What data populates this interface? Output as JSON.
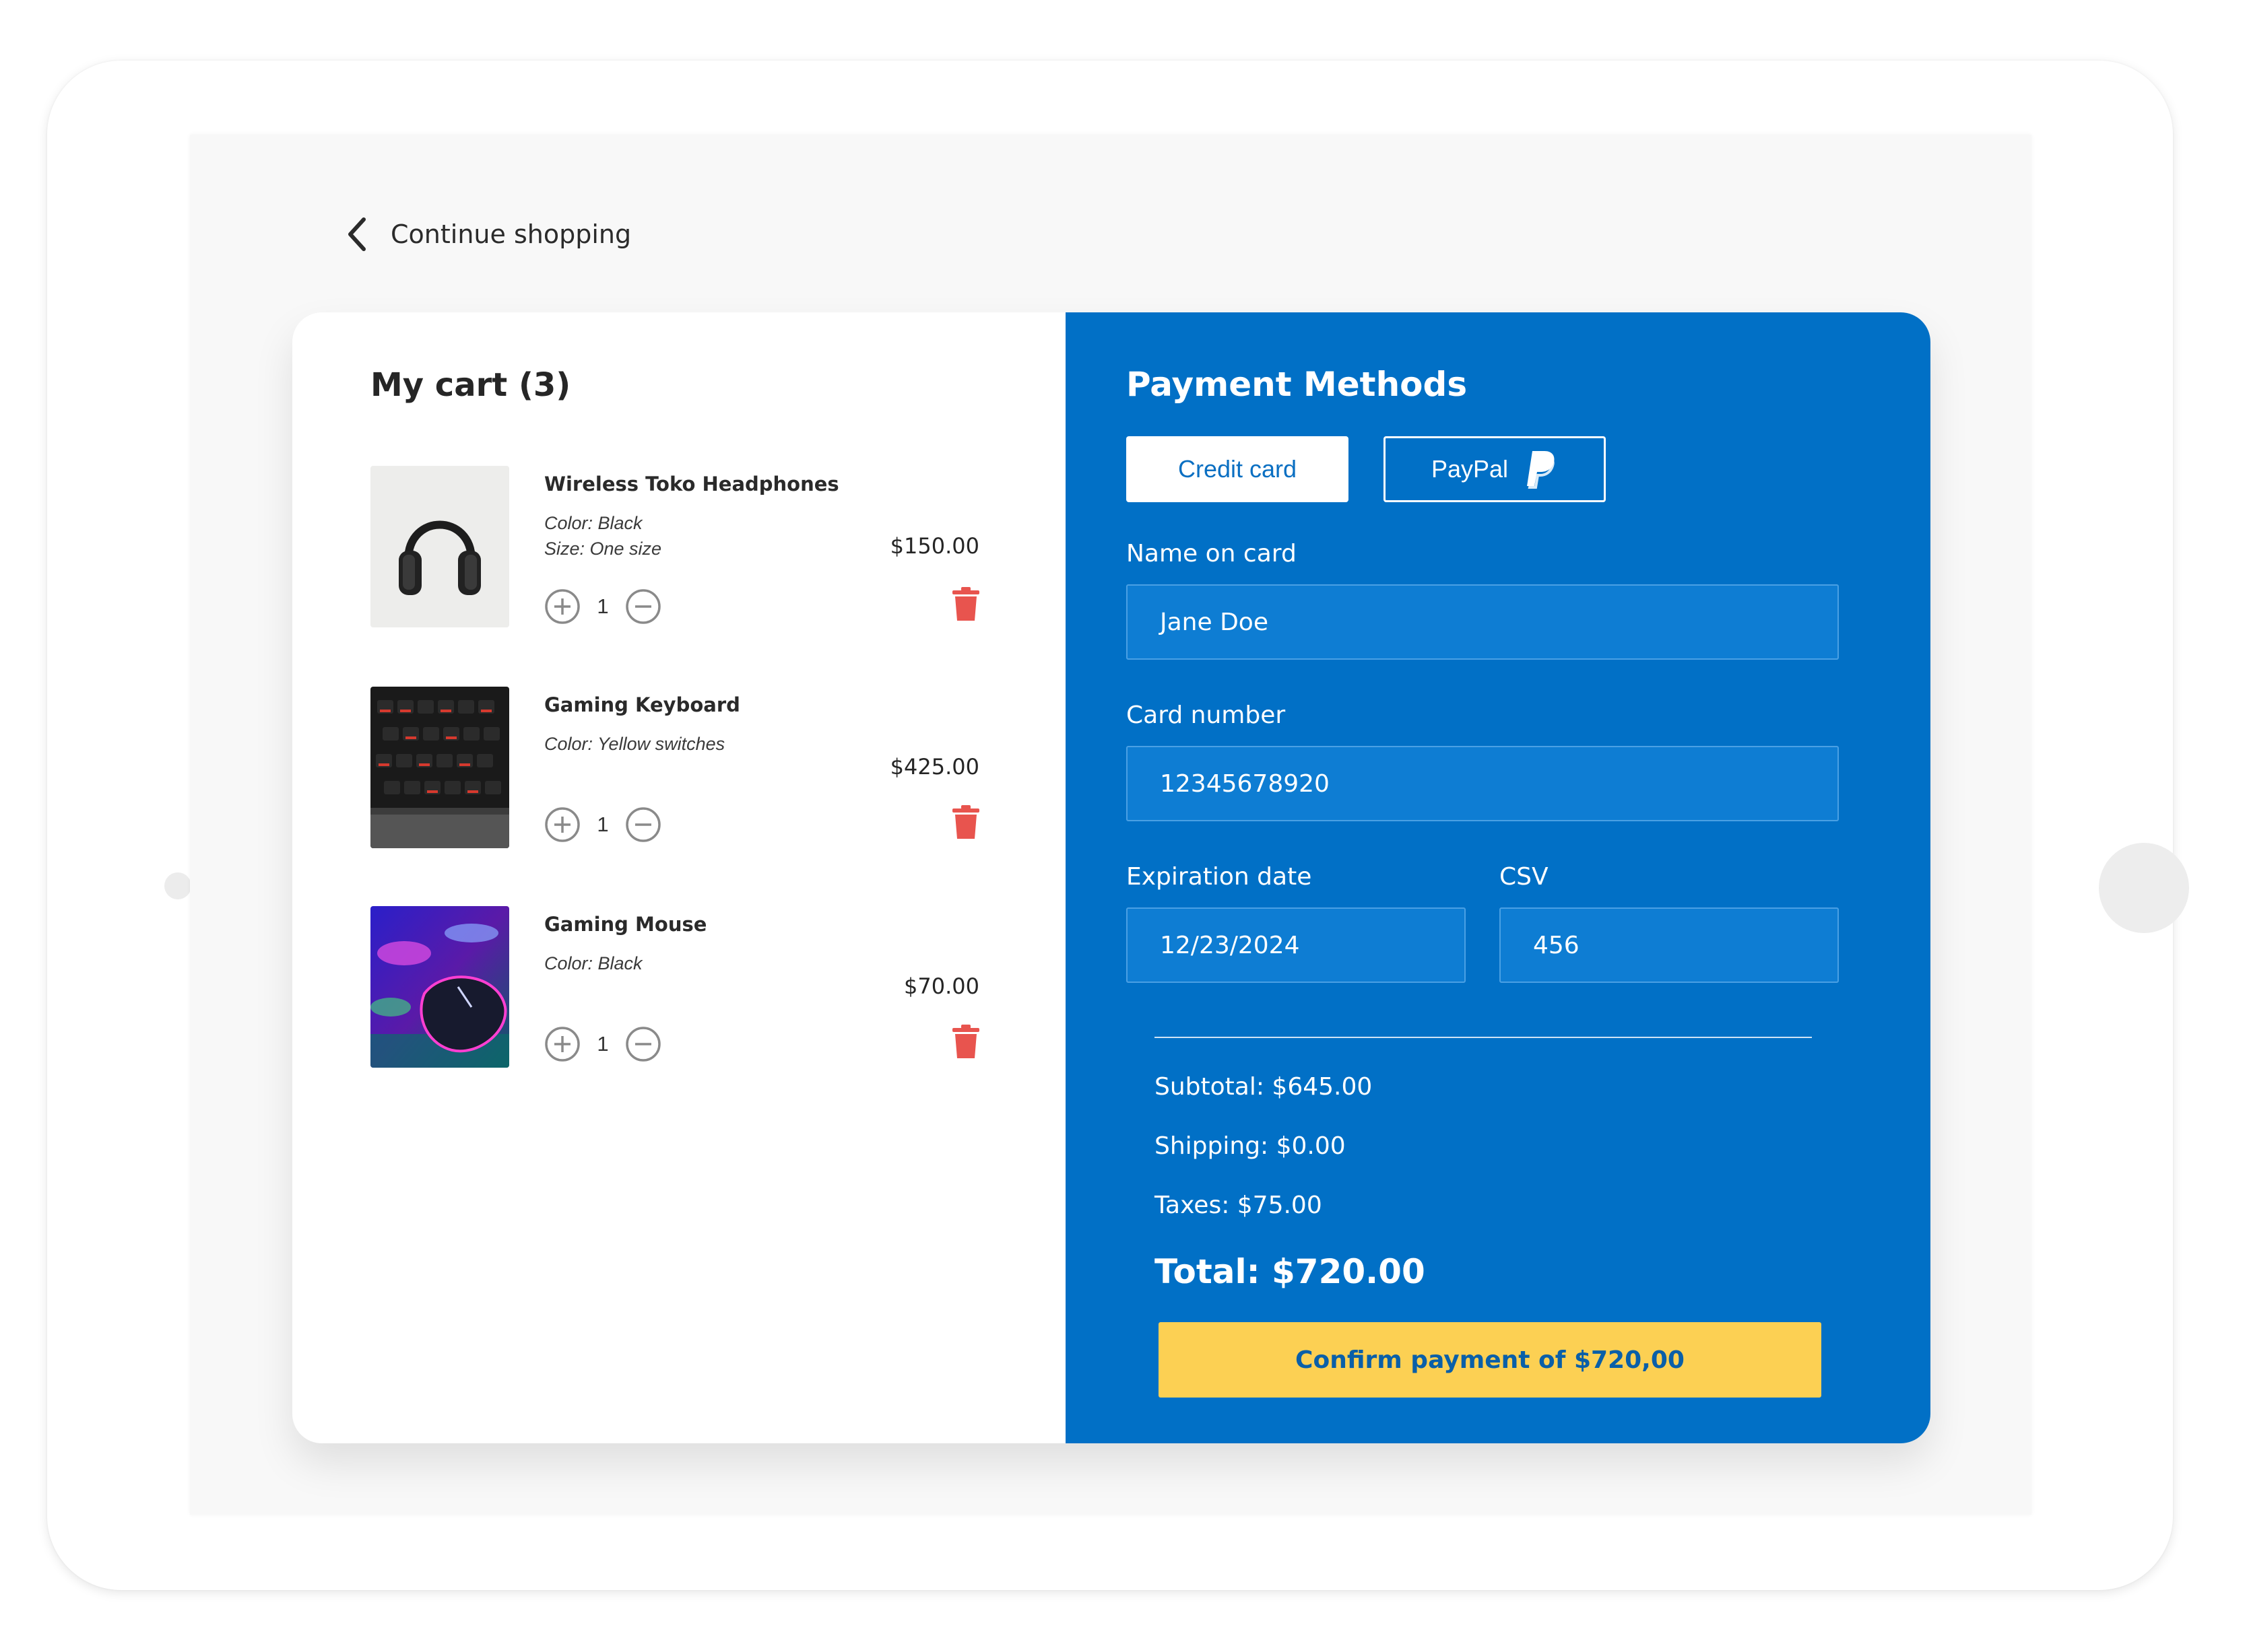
{
  "nav": {
    "back_label": "Continue shopping"
  },
  "cart": {
    "title": "My cart (3)",
    "items": [
      {
        "name": "Wireless Toko Headphones",
        "attrs": [
          "Color: Black",
          "Size: One size"
        ],
        "quantity": "1",
        "price": "$150.00",
        "image": "headphones"
      },
      {
        "name": "Gaming Keyboard",
        "attrs": [
          "Color: Yellow switches"
        ],
        "quantity": "1",
        "price": "$425.00",
        "image": "keyboard"
      },
      {
        "name": "Gaming Mouse",
        "attrs": [
          "Color: Black"
        ],
        "quantity": "1",
        "price": "$70.00",
        "image": "mouse"
      }
    ]
  },
  "payment": {
    "title": "Payment Methods",
    "methods": {
      "credit_card": "Credit card",
      "paypal": "PayPal"
    },
    "fields": {
      "name_label": "Name on card",
      "name_value": "Jane Doe",
      "number_label": "Card number",
      "number_value": "12345678920",
      "expiry_label": "Expiration date",
      "expiry_value": "12/23/2024",
      "csv_label": "CSV",
      "csv_value": "456"
    },
    "summary": {
      "subtotal": "Subtotal: $645.00",
      "shipping": "Shipping: $0.00",
      "taxes": "Taxes: $75.00",
      "total": "Total: $720.00"
    },
    "confirm_label": "Confirm payment of $720,00"
  },
  "colors": {
    "brand_blue": "#0170c6",
    "confirm_yellow": "#fcd053",
    "delete_red": "#e8544e"
  },
  "icons": [
    "chevron-left-icon",
    "plus-circle-icon",
    "minus-circle-icon",
    "trash-icon",
    "paypal-icon"
  ]
}
